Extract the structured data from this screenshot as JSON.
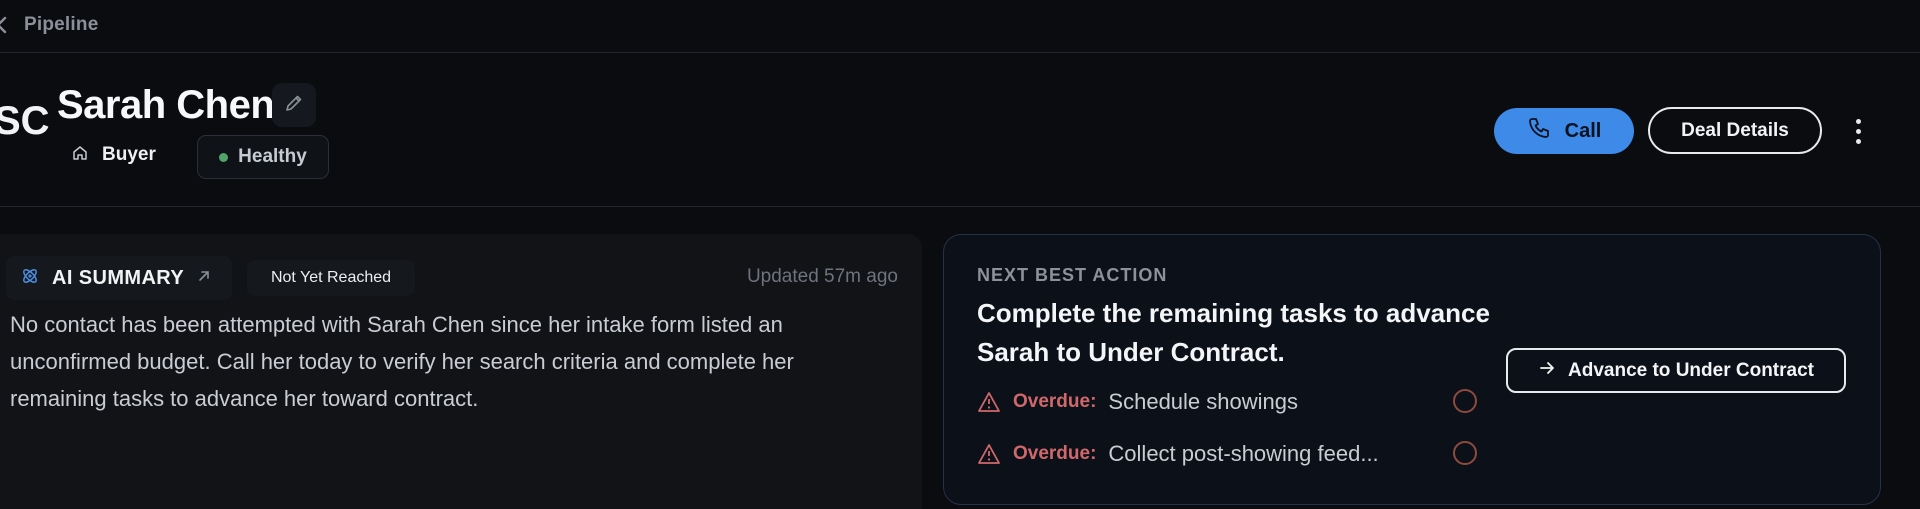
{
  "breadcrumb": {
    "label": "Pipeline"
  },
  "contact": {
    "initials": "SC",
    "name": "Sarah Chen",
    "type": "Buyer",
    "health": "Healthy"
  },
  "actions": {
    "call": "Call",
    "deal_details": "Deal Details"
  },
  "summary": {
    "title": "AI SUMMARY",
    "status": "Not Yet Reached",
    "updated": "Updated 57m ago",
    "text": "No contact has been attempted with Sarah Chen since her intake form listed an unconfirmed budget. Call her today to verify her search criteria and complete her remaining tasks to advance her toward contract."
  },
  "next_action": {
    "label": "NEXT BEST ACTION",
    "title": "Complete the remaining tasks to advance Sarah to Under Contract.",
    "button": "Advance to Under Contract",
    "tasks": [
      {
        "status": "Overdue:",
        "name": "Schedule showings"
      },
      {
        "status": "Overdue:",
        "name": "Collect post-showing feed..."
      }
    ]
  },
  "colors": {
    "accent": "#3d8ae8",
    "overdue": "#d0686b",
    "healthy": "#4fa56a",
    "background": "#0a0c10"
  }
}
